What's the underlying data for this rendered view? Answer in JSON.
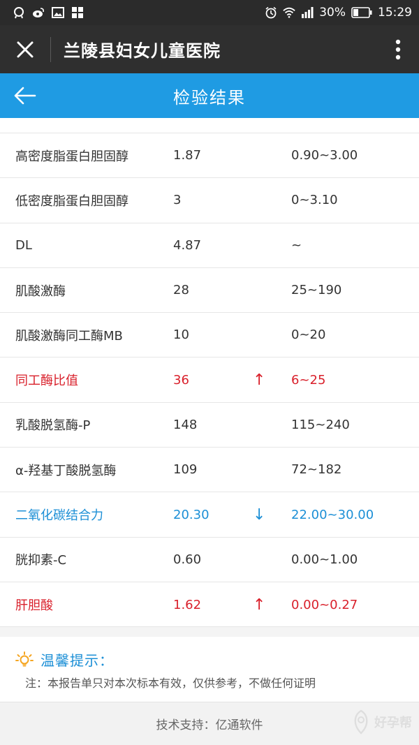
{
  "status_bar": {
    "battery": "30%",
    "time": "15:29"
  },
  "app_bar": {
    "title": "兰陵县妇女儿童医院"
  },
  "header": {
    "title": "检验结果"
  },
  "results": [
    {
      "name": "高密度脂蛋白胆固醇",
      "value": "1.87",
      "flag": "",
      "range": "0.90~3.00",
      "status": "normal"
    },
    {
      "name": "低密度脂蛋白胆固醇",
      "value": "3",
      "flag": "",
      "range": "0~3.10",
      "status": "normal"
    },
    {
      "name": "DL",
      "value": "4.87",
      "flag": "",
      "range": "~",
      "status": "normal"
    },
    {
      "name": "肌酸激酶",
      "value": "28",
      "flag": "",
      "range": "25~190",
      "status": "normal"
    },
    {
      "name": "肌酸激酶同工酶MB",
      "value": "10",
      "flag": "",
      "range": "0~20",
      "status": "normal"
    },
    {
      "name": "同工酶比值",
      "value": "36",
      "flag": "↑",
      "range": "6~25",
      "status": "high"
    },
    {
      "name": "乳酸脱氢酶-P",
      "value": "148",
      "flag": "",
      "range": "115~240",
      "status": "normal"
    },
    {
      "name": "α-羟基丁酸脱氢酶",
      "value": "109",
      "flag": "",
      "range": "72~182",
      "status": "normal"
    },
    {
      "name": "二氧化碳结合力",
      "value": "20.30",
      "flag": "↓",
      "range": "22.00~30.00",
      "status": "low"
    },
    {
      "name": "胱抑素-C",
      "value": "0.60",
      "flag": "",
      "range": "0.00~1.00",
      "status": "normal"
    },
    {
      "name": "肝胆酸",
      "value": "1.62",
      "flag": "↑",
      "range": "0.00~0.27",
      "status": "high"
    }
  ],
  "tip": {
    "title": "温馨提示：",
    "note": "注：本报告单只对本次标本有效，仅供参考，不做任何证明"
  },
  "footer": {
    "text": "技术支持：亿通软件",
    "watermark": "好孕帮"
  },
  "colors": {
    "header_blue": "#1f9be3",
    "high_red": "#d9202b",
    "low_blue": "#1c8fd6",
    "tip_orange": "#f5a623"
  },
  "icons": [
    "qq-icon",
    "weibo-icon",
    "gallery-icon",
    "apps-icon",
    "alarm-icon",
    "wifi-icon",
    "signal-icon",
    "battery-icon",
    "close-icon",
    "more-vertical-icon",
    "back-arrow-icon",
    "lightbulb-icon",
    "watermark-logo-icon"
  ]
}
